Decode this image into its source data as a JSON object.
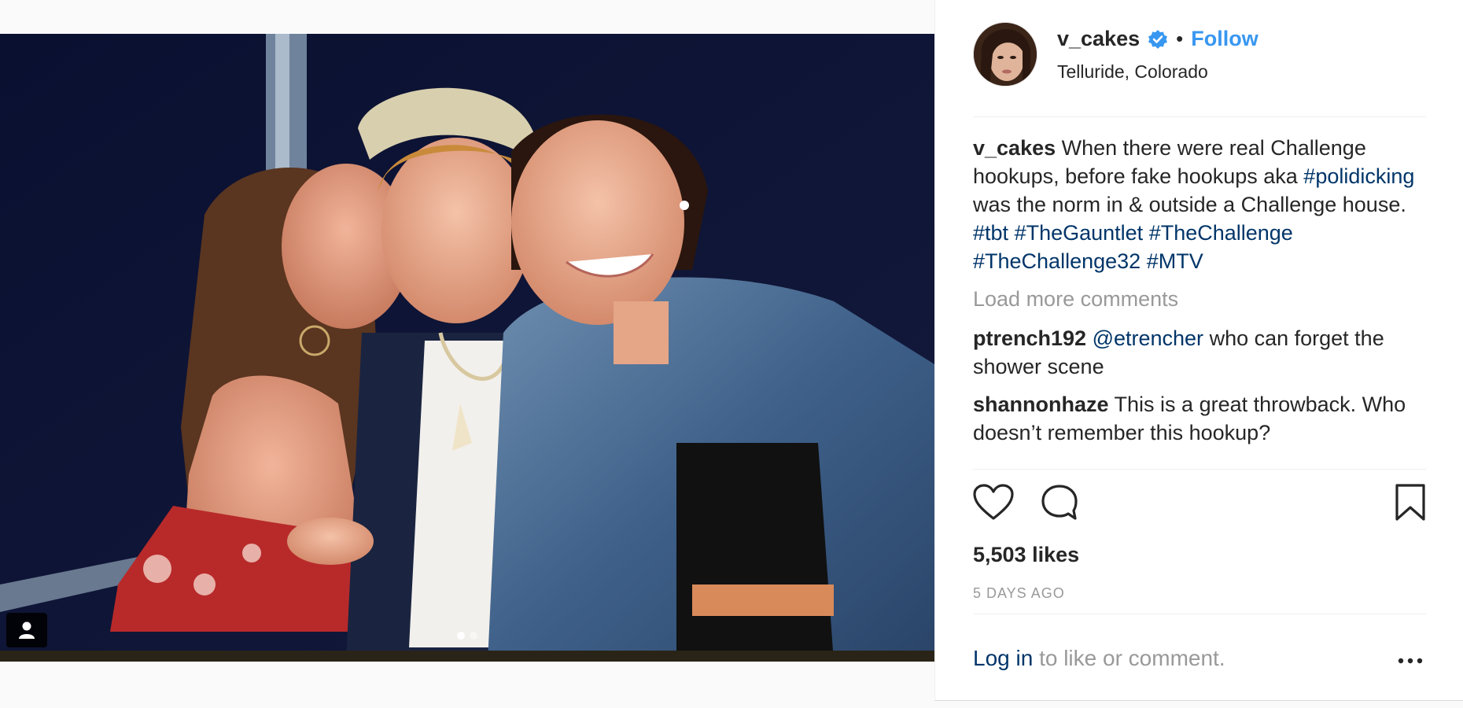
{
  "post": {
    "username": "v_cakes",
    "follow_label": "Follow",
    "separator": "•",
    "location": "Telluride, Colorado",
    "caption": {
      "author": "v_cakes",
      "text_1": " When there were real Challenge hookups, before fake hookups aka ",
      "tag_1": "#polidicking",
      "text_2": " was the norm in & outside a Challenge house. ",
      "tag_2": "#tbt",
      "tag_3": "#TheGauntlet",
      "tag_4": "#TheChallenge",
      "tag_5": "#TheChallenge32",
      "tag_6": "#MTV"
    },
    "load_more": "Load more comments",
    "comments": [
      {
        "author": "ptrench192",
        "mention": "@etrencher",
        "text": " who can forget the shower scene"
      },
      {
        "author": "shannonhaze",
        "text": " This is a great throwback. Who doesn’t remember this hookup?"
      }
    ],
    "likes": "5,503 likes",
    "time": "5 DAYS AGO",
    "login_link": "Log in",
    "login_rest": " to like or comment."
  },
  "carousel": {
    "slides": 2,
    "active": 0
  },
  "icons": {
    "verified": "verified-badge-icon",
    "like": "heart-icon",
    "comment": "comment-bubble-icon",
    "save": "bookmark-icon",
    "more": "more-options-icon",
    "tag": "user-tag-icon"
  },
  "colors": {
    "link": "#003569",
    "follow": "#3897f0",
    "muted": "#999999",
    "text": "#262626"
  }
}
